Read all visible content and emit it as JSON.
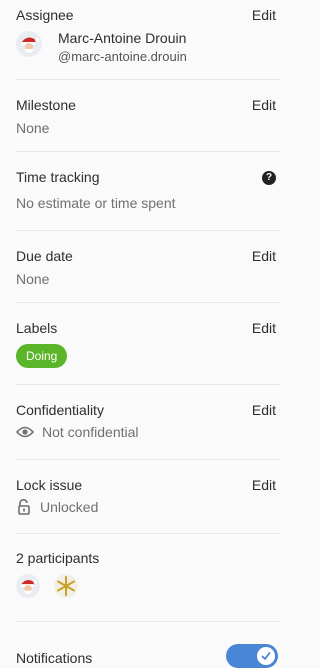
{
  "assignee": {
    "title": "Assignee",
    "edit": "Edit",
    "name": "Marc-Antoine Drouin",
    "handle": "@marc-antoine.drouin",
    "avatar_icon": "santa-avatar"
  },
  "milestone": {
    "title": "Milestone",
    "edit": "Edit",
    "value": "None"
  },
  "time_tracking": {
    "title": "Time tracking",
    "help_icon": "question-circle-icon",
    "help_text": "?",
    "value": "No estimate or time spent"
  },
  "due_date": {
    "title": "Due date",
    "edit": "Edit",
    "value": "None"
  },
  "labels": {
    "title": "Labels",
    "edit": "Edit",
    "items": [
      "Doing"
    ],
    "color": "#5bb528"
  },
  "confidentiality": {
    "title": "Confidentiality",
    "edit": "Edit",
    "value": "Not confidential",
    "icon": "eye-icon"
  },
  "lock": {
    "title": "Lock issue",
    "edit": "Edit",
    "value": "Unlocked",
    "icon": "unlock-icon"
  },
  "participants": {
    "title": "2 participants",
    "avatars": [
      "santa-avatar",
      "snowflake-avatar"
    ]
  },
  "notifications": {
    "title": "Notifications",
    "enabled": true
  }
}
